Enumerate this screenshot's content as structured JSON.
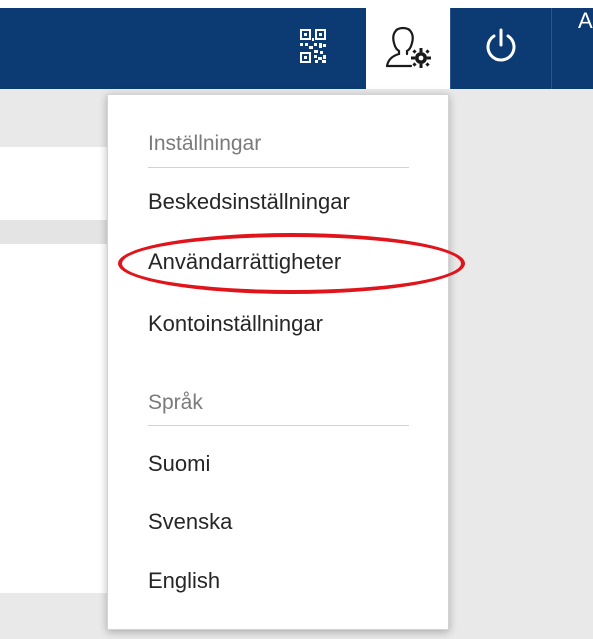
{
  "topbar": {
    "qr_icon": "qr-code-icon",
    "user_settings_icon": "user-settings-icon",
    "power_icon": "power-icon",
    "extra_label": "A",
    "colors": {
      "bar": "#0c3a73",
      "active_button": "#ffffff"
    }
  },
  "menu": {
    "settings_header": "Inställningar",
    "items_settings": [
      {
        "label": "Beskedsinställningar"
      },
      {
        "label": "Användarrättigheter"
      },
      {
        "label": "Kontoinställningar"
      }
    ],
    "language_header": "Språk",
    "items_language": [
      {
        "label": "Suomi"
      },
      {
        "label": "Svenska"
      },
      {
        "label": "English"
      }
    ]
  },
  "annotation": {
    "color": "#e0141b"
  }
}
